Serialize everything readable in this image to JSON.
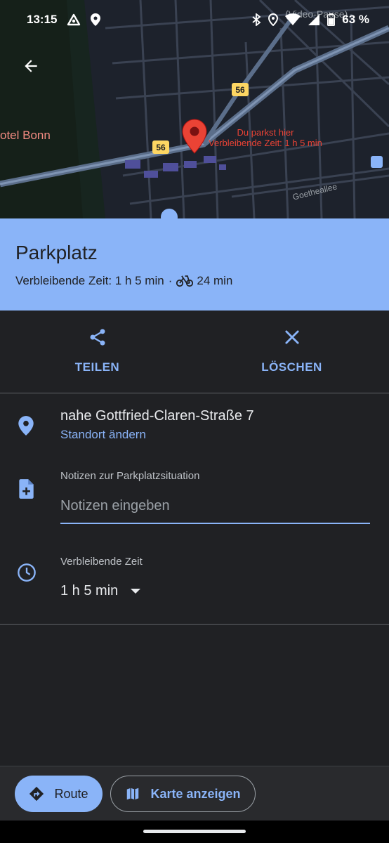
{
  "status_bar": {
    "time": "13:15",
    "overlay_text": "(Video-Pause)",
    "battery": "63 %"
  },
  "map": {
    "hotel_label": "otel Bonn",
    "parking_label_line1": "Du parkst hier",
    "parking_label_line2": "Verbleibende Zeit: 1 h 5 min",
    "street_label": "Goetheallee",
    "route_shield_a": "56",
    "route_shield_b": "56"
  },
  "header": {
    "title": "Parkplatz",
    "remaining_time_text": "Verbleibende Zeit: 1 h 5 min",
    "separator": "·",
    "bike_time": "24 min"
  },
  "actions": {
    "share_label": "TEILEN",
    "delete_label": "LÖSCHEN"
  },
  "details": {
    "address": "nahe Gottfried-Claren-Straße 7",
    "change_location": "Standort ändern",
    "notes_label": "Notizen zur Parkplatzsituation",
    "notes_placeholder": "Notizen eingeben",
    "notes_value": "",
    "time_label": "Verbleibende Zeit",
    "time_value": "1 h 5 min"
  },
  "bottom": {
    "route_label": "Route",
    "show_map_label": "Karte anzeigen"
  },
  "colors": {
    "accent": "#8ab4f8",
    "background": "#202124",
    "pin": "#ea4335"
  }
}
